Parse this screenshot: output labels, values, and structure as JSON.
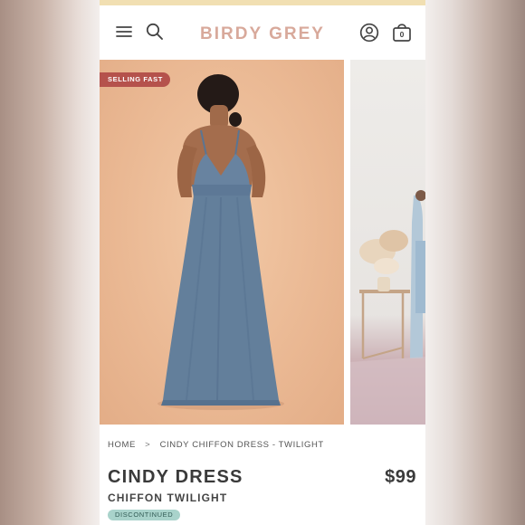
{
  "header": {
    "brand": "BIRDY GREY",
    "icons": [
      "menu-icon",
      "search-icon",
      "account-icon",
      "cart-icon"
    ],
    "cart_count": "0"
  },
  "gallery": {
    "badge": "SELLING FAST",
    "dress_color": "#637f9b"
  },
  "breadcrumb": {
    "home": "HOME",
    "separator": ">",
    "current": "CINDY CHIFFON DRESS - TWILIGHT"
  },
  "product": {
    "name": "CINDY DRESS",
    "price": "$99",
    "subtitle": "CHIFFON TWILIGHT",
    "status": "DISCONTINUED"
  },
  "colors": {
    "brand": "#d8a99b",
    "badge": "#b5524c",
    "status_badge": "#a9d3cb"
  }
}
